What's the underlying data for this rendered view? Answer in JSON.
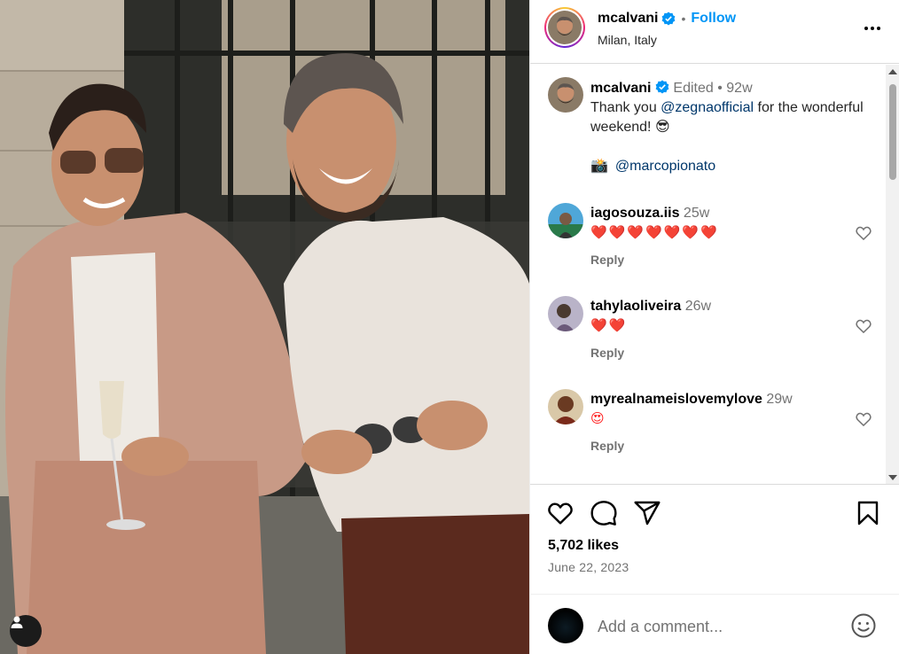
{
  "header": {
    "username": "mcalvani",
    "separator": "•",
    "follow_label": "Follow",
    "location": "Milan, Italy",
    "more_icon": "more-horizontal-icon",
    "verified_icon": "verified-badge-icon"
  },
  "caption": {
    "username": "mcalvani",
    "edited": "Edited",
    "separator": "•",
    "age": "92w",
    "text_before": "Thank you ",
    "mention": "@zegnaofficial",
    "text_after": " for the wonderful weekend! 😎",
    "camera_emoji": "📸",
    "credit": "@marcopionato"
  },
  "comments": [
    {
      "username": "iagosouza.iis",
      "age": "25w",
      "text": "❤️❤️❤️❤️❤️❤️❤️",
      "reply_label": "Reply"
    },
    {
      "username": "tahylaoliveira",
      "age": "26w",
      "text": "❤️❤️",
      "reply_label": "Reply"
    },
    {
      "username": "myrealnameislovemylove",
      "age": "29w",
      "text": "😍",
      "reply_label": "Reply"
    }
  ],
  "actions": {
    "like_icon": "heart-icon",
    "comment_icon": "comment-icon",
    "share_icon": "paper-plane-icon",
    "save_icon": "bookmark-icon"
  },
  "likes": "5,702 likes",
  "date": "June 22, 2023",
  "add_comment": {
    "placeholder": "Add a comment...",
    "emoji_icon": "smiley-icon"
  },
  "colors": {
    "accent": "#0095f6",
    "mention": "#00376b",
    "muted": "#737373"
  }
}
